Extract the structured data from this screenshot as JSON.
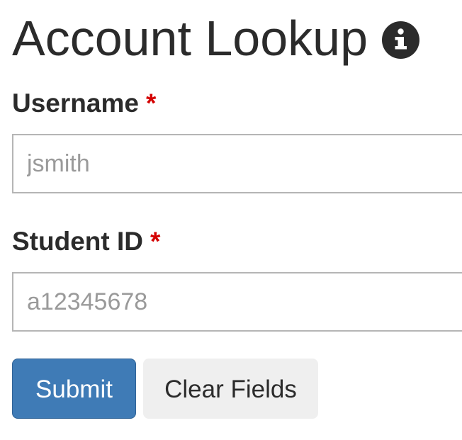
{
  "header": {
    "title": "Account Lookup",
    "info_icon": "info-circle-icon"
  },
  "form": {
    "username": {
      "label": "Username",
      "required_marker": "*",
      "placeholder": "jsmith",
      "value": ""
    },
    "student_id": {
      "label": "Student ID",
      "required_marker": "*",
      "placeholder": "a12345678",
      "value": ""
    }
  },
  "actions": {
    "submit_label": "Submit",
    "clear_label": "Clear Fields"
  },
  "colors": {
    "text": "#2b2b2b",
    "required": "#d40000",
    "primary_button": "#3f7bb6",
    "secondary_button": "#efefef",
    "input_border": "#b5b5b5",
    "placeholder": "#9a9a9a"
  }
}
